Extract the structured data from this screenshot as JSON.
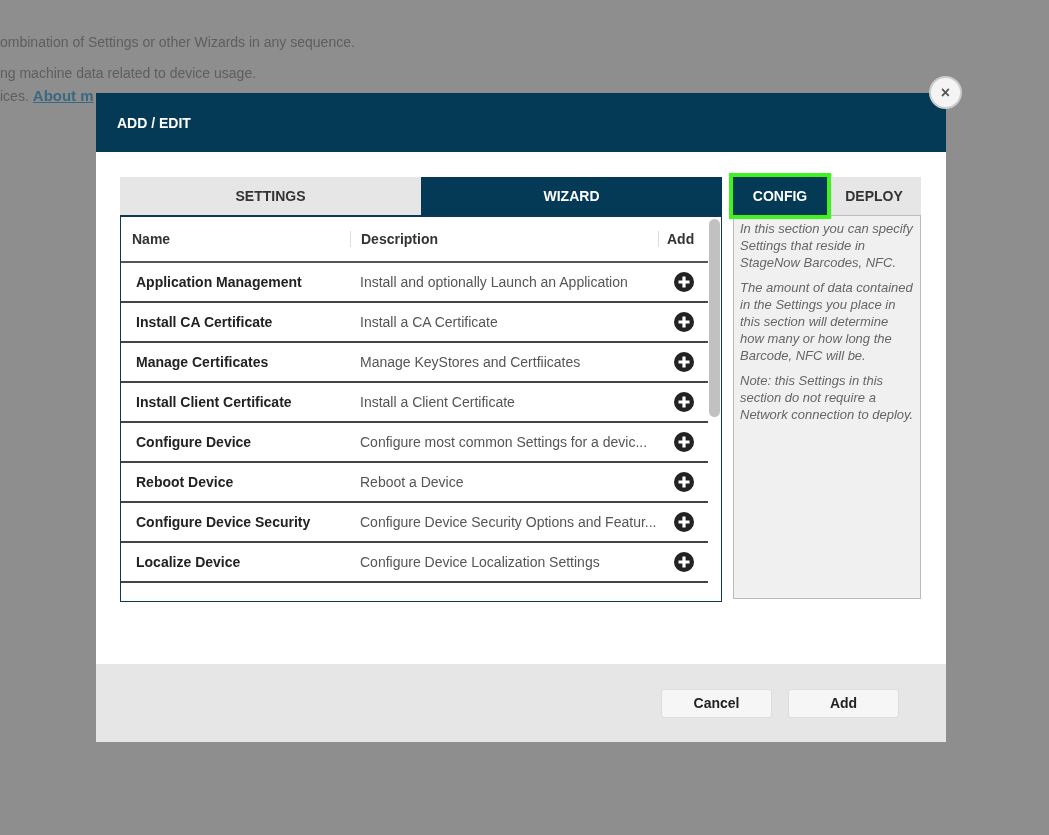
{
  "background_page": {
    "lines": [
      "ombination of Settings or other Wizards in any sequence.",
      "ng machine data related to device usage."
    ],
    "last_line": {
      "text": "ices.",
      "link": "About m"
    }
  },
  "close_button": {
    "label": "×"
  },
  "dialog": {
    "title": "ADD / EDIT",
    "tabs": [
      {
        "label": "SETTINGS",
        "selected": false
      },
      {
        "label": "WIZARD",
        "selected": true
      }
    ],
    "table": {
      "columns": [
        "Name",
        "Description",
        "Add"
      ],
      "rows": [
        {
          "name": "Application Management",
          "description": "Install and optionally Launch an Application"
        },
        {
          "name": "Install CA Certificate",
          "description": "Install a CA Certificate"
        },
        {
          "name": "Manage Certificates",
          "description": "Manage KeyStores and Certfiicates"
        },
        {
          "name": "Install Client Certificate",
          "description": "Install a Client Certificate"
        },
        {
          "name": "Configure Device",
          "description": "Configure most common Settings for a devic..."
        },
        {
          "name": "Reboot Device",
          "description": "Reboot a Device"
        },
        {
          "name": "Configure Device Security",
          "description": "Configure Device Security Options and Featur..."
        },
        {
          "name": "Localize Device",
          "description": "Configure Device Localization Settings"
        }
      ]
    },
    "side_tabs": [
      {
        "label": "CONFIG",
        "selected": true,
        "highlighted": true
      },
      {
        "label": "DEPLOY",
        "selected": false,
        "highlighted": false
      }
    ],
    "side_info": [
      "In this section you can specify Settings that reside in StageNow Barcodes, NFC.",
      "The amount of data contained in the Settings you place in this section will determine how many or how long the Barcode, NFC will be.",
      "Note: this Settings in this section do not require a Network connection to deploy."
    ],
    "buttons": [
      "Cancel",
      "Add"
    ]
  }
}
